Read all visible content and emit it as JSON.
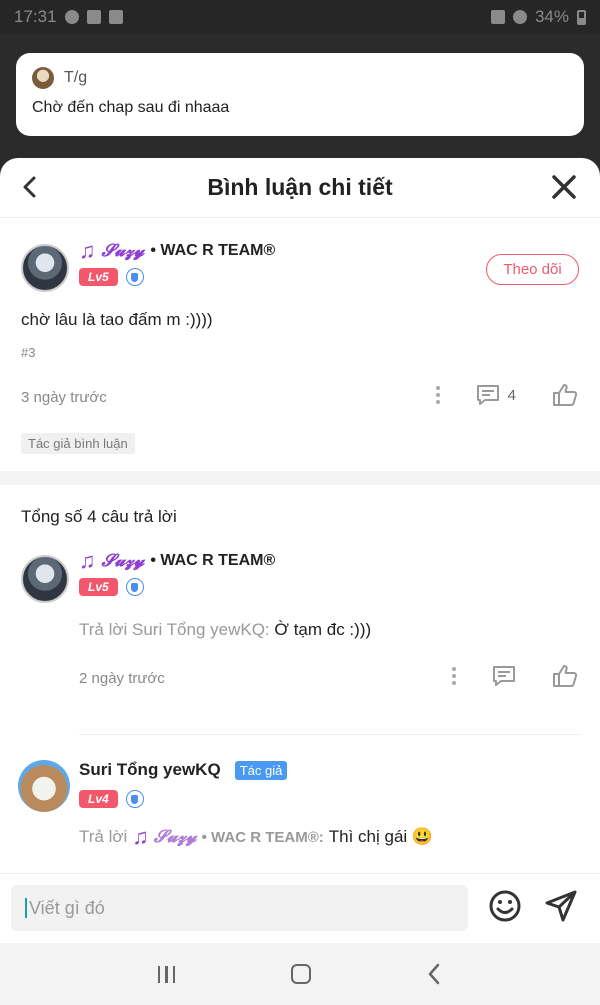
{
  "status_bar": {
    "time": "17:31",
    "battery": "34%"
  },
  "notification": {
    "sender": "T/g",
    "message": "Chờ đến chap sau đi nhaaa"
  },
  "header": {
    "title": "Bình luận chi tiết"
  },
  "main_comment": {
    "username_styled": "𝓢𝓾𝔃𝔂",
    "team": "• WAC R TEAM®",
    "level": "Lv5",
    "follow_label": "Theo dõi",
    "text": "chờ lâu là tao đấm m :))))",
    "number": "#3",
    "time": "3 ngày trước",
    "reply_count": "4",
    "author_tag": "Tác giả bình luận"
  },
  "replies_header": "Tổng số 4 câu trả lời",
  "replies": [
    {
      "username_styled": "𝓢𝓾𝔃𝔂",
      "team": "• WAC R TEAM®",
      "level": "Lv5",
      "reply_prefix": "Trả lời Suri Tổng yewKQ:",
      "reply_text": "Ờ tạm đc :)))",
      "time": "2 ngày trước"
    },
    {
      "username": "Suri Tổng yewKQ",
      "author_badge": "Tác giả",
      "level": "Lv4",
      "reply_prefix": "Trả lời",
      "reply_target_styled": "𝓢𝓾𝔃𝔂",
      "reply_target_team": "• WAC R TEAM®:",
      "reply_text": "Thì chị gái 😃"
    }
  ],
  "input": {
    "placeholder": "Viết gì đó"
  },
  "icons": {
    "back": "chevron-left-icon",
    "close": "close-icon",
    "more": "more-vertical-icon",
    "comment": "comment-icon",
    "like": "thumbs-up-icon",
    "emoji": "smile-icon",
    "send": "send-icon"
  },
  "colors": {
    "accent": "#ef5a6c",
    "level": "#f2576c",
    "author_badge": "#4b9af1",
    "username": "#8e3fd1"
  }
}
